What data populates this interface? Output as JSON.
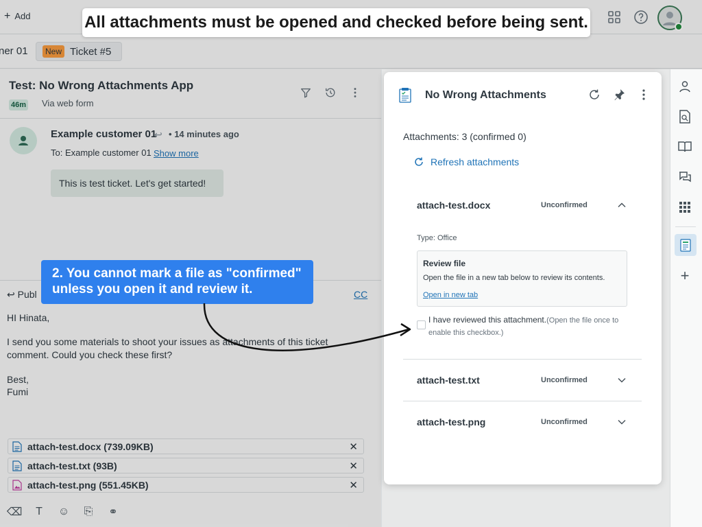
{
  "topbar": {
    "add_label": "Add"
  },
  "tabs": {
    "previous_label": "ner 01",
    "active_badge": "New",
    "active_label": "Ticket #5"
  },
  "ticket": {
    "title": "Test: No Wrong Attachments App",
    "age_badge": "46m",
    "via": "Via web form",
    "customer_name": "Example customer 01",
    "separator": "•",
    "time_ago": "14 minutes ago",
    "to_line": "To: Example customer 01",
    "show_more": "Show more",
    "message": "This is test ticket. Let's get started!"
  },
  "composer": {
    "channel": "Publ",
    "cc": "CC",
    "body_lines": [
      "HI Hinata,",
      "I send you some materials to shoot your issues as attachments of this ticket",
      "comment. Could you check these first?",
      "Best,",
      "Fumi"
    ],
    "attachments": [
      {
        "name": "attach-test.docx (739.09KB)",
        "remove": "✕",
        "color": "#1f73b7"
      },
      {
        "name": "attach-test.txt (93B)",
        "remove": "✕",
        "color": "#1f73b7"
      },
      {
        "name": "attach-test.png (551.45KB)",
        "remove": "✕",
        "color": "#c23ea0"
      }
    ]
  },
  "app": {
    "title": "No Wrong Attachments",
    "count_text": "Attachments: 3 (confirmed 0)",
    "refresh_label": "Refresh attachments",
    "files": [
      {
        "name": "attach-test.docx",
        "status": "Unconfirmed",
        "expanded": true
      },
      {
        "name": "attach-test.txt",
        "status": "Unconfirmed",
        "expanded": false
      },
      {
        "name": "attach-test.png",
        "status": "Unconfirmed",
        "expanded": false
      }
    ],
    "type_text": "Type: Office",
    "review_title": "Review file",
    "review_desc": "Open the file in a new tab below to review its contents.",
    "review_link": "Open in new tab",
    "checkbox_label": "I have reviewed this attachment.",
    "checkbox_hint": "(Open the file once to enable this checkbox.)",
    "checkbox_checked": false
  },
  "callouts": {
    "top": "All attachments must be opened and checked before being sent.",
    "step2_line1": "2. You cannot mark a file as \"confirmed\"",
    "step2_line2": "unless you open it and review it."
  },
  "colors": {
    "accent_blue": "#1f73b7",
    "callout_blue": "#2f80ed",
    "new_badge": "#f79a3e",
    "presence_green": "#1f8a3b"
  }
}
